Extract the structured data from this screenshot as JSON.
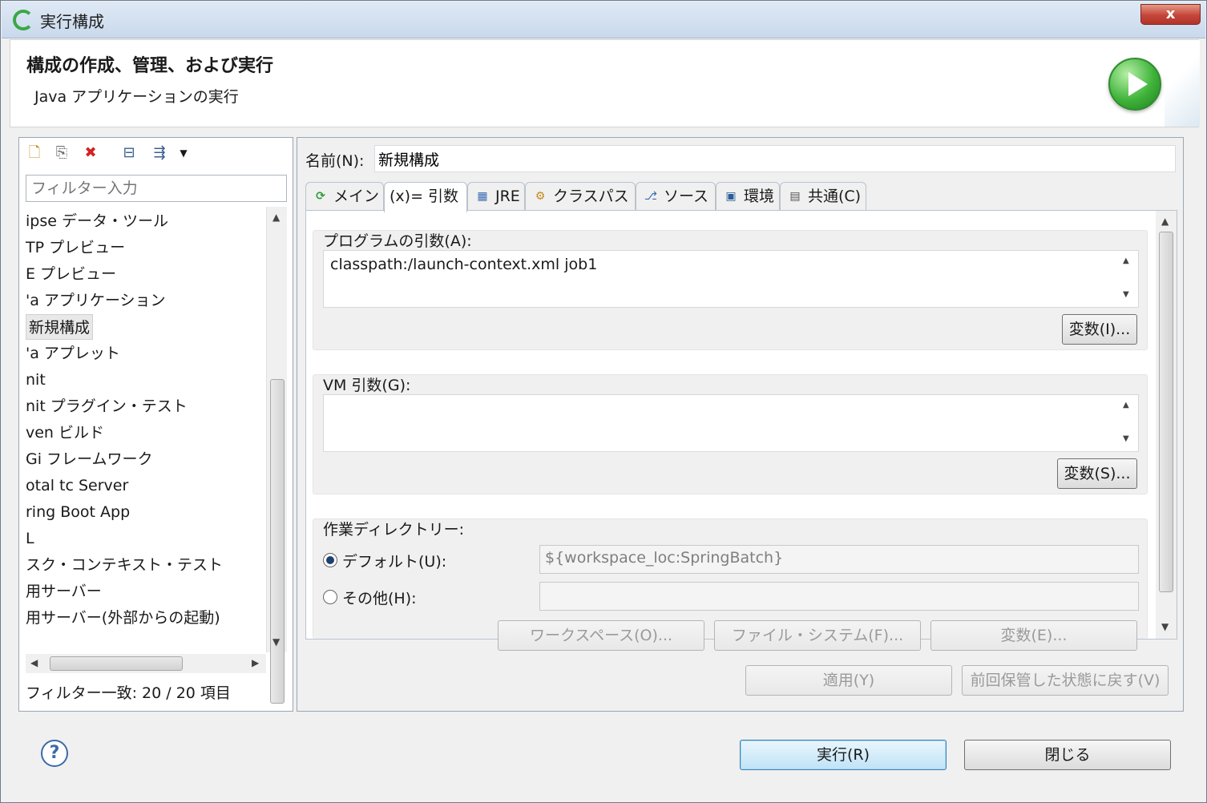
{
  "window": {
    "title": "実行構成",
    "close_label": "x"
  },
  "banner": {
    "title": "構成の作成、管理、および実行",
    "subtitle": "Java アプリケーションの実行"
  },
  "left": {
    "filter_placeholder": "フィルター入力",
    "tree_items": [
      "ipse データ・ツール",
      "TP プレビュー",
      "E プレビュー",
      "'a アプリケーション",
      "新規構成",
      "'a アプレット",
      "nit",
      "nit プラグイン・テスト",
      "ven ビルド",
      "Gi フレームワーク",
      "otal tc Server",
      "ring Boot App",
      "L",
      "スク・コンテキスト・テスト",
      "用サーバー",
      "用サーバー(外部からの起動)"
    ],
    "filter_status": "フィルター一致: 20 / 20 項目"
  },
  "right": {
    "name_label": "名前(N):",
    "name_value": "新規構成",
    "tabs": [
      {
        "label": "メイン"
      },
      {
        "label": "(x)= 引数"
      },
      {
        "label": "JRE"
      },
      {
        "label": "クラスパス"
      },
      {
        "label": "ソース"
      },
      {
        "label": "環境"
      },
      {
        "label": "共通(C)"
      }
    ],
    "program_args_label": "プログラムの引数(A):",
    "program_args_value": "classpath:/launch-context.xml job1",
    "variables_i_label": "変数(I)...",
    "vm_args_label": "VM 引数(G):",
    "vm_args_value": "",
    "variables_s_label": "変数(S)...",
    "workdir_label": "作業ディレクトリー:",
    "default_label": "デフォルト(U):",
    "default_value": "${workspace_loc:SpringBatch}",
    "other_label": "その他(H):",
    "other_value": "",
    "workspace_button": "ワークスペース(O)...",
    "filesystem_button": "ファイル・システム(F)...",
    "variables_e_button": "変数(E)...",
    "apply_button": "適用(Y)",
    "revert_button": "前回保管した状態に戻す(V)"
  },
  "footer": {
    "run_button": "実行(R)",
    "close_button": "閉じる"
  }
}
